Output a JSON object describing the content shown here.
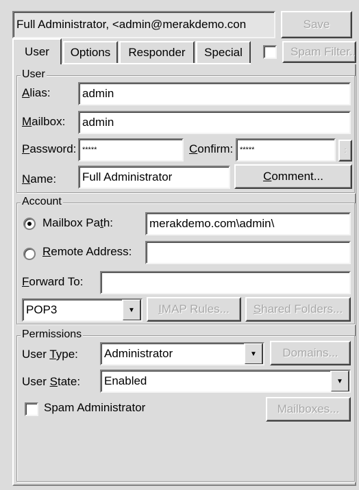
{
  "header": {
    "user_display": "Full Administrator, <admin@merakdemo.con",
    "save_label": "Save"
  },
  "tabs": [
    {
      "label": "User",
      "active": true
    },
    {
      "label": "Options",
      "active": false
    },
    {
      "label": "Responder",
      "active": false
    },
    {
      "label": "Special",
      "active": false
    }
  ],
  "spam_filter": {
    "label": "Spam Filter...",
    "checked": false
  },
  "user_group": {
    "legend": "User",
    "alias_label": "Alias:",
    "alias_value": "admin",
    "mailbox_label": "Mailbox:",
    "mailbox_value": "admin",
    "password_label": "Password:",
    "password_value": "*****",
    "confirm_label": "Confirm:",
    "confirm_value": "*****",
    "name_label": "Name:",
    "name_value": "Full Administrator",
    "comment_label": "Comment..."
  },
  "account_group": {
    "legend": "Account",
    "mailbox_path_label": "Mailbox Path:",
    "mailbox_path_value": "merakdemo.com\\admin\\",
    "mailbox_path_selected": true,
    "remote_address_label": "Remote Address:",
    "remote_address_value": "",
    "forward_to_label": "Forward To:",
    "forward_to_value": "",
    "protocol_value": "POP3",
    "imap_rules_label": "IMAP Rules...",
    "shared_folders_label": "Shared Folders..."
  },
  "permissions_group": {
    "legend": "Permissions",
    "user_type_label": "User Type:",
    "user_type_value": "Administrator",
    "domains_label": "Domains...",
    "user_state_label": "User State:",
    "user_state_value": "Enabled",
    "spam_admin_label": "Spam Administrator",
    "spam_admin_checked": false,
    "mailboxes_label": "Mailboxes..."
  },
  "colors": {
    "face": "#dcdcdc",
    "field": "#ffffff",
    "disabled_text": "#a8a8a8"
  }
}
